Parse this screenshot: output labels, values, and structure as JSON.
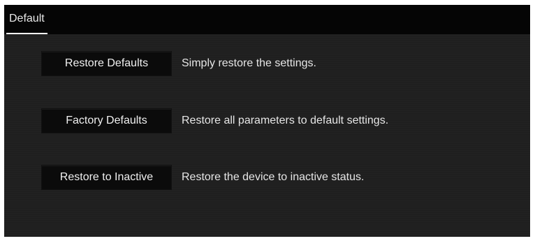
{
  "tabs": [
    {
      "label": "Default"
    }
  ],
  "options": [
    {
      "button_label": "Restore Defaults",
      "description": "Simply restore the settings."
    },
    {
      "button_label": "Factory Defaults",
      "description": "Restore all parameters to default settings."
    },
    {
      "button_label": "Restore to Inactive",
      "description": "Restore the device to inactive status."
    }
  ]
}
